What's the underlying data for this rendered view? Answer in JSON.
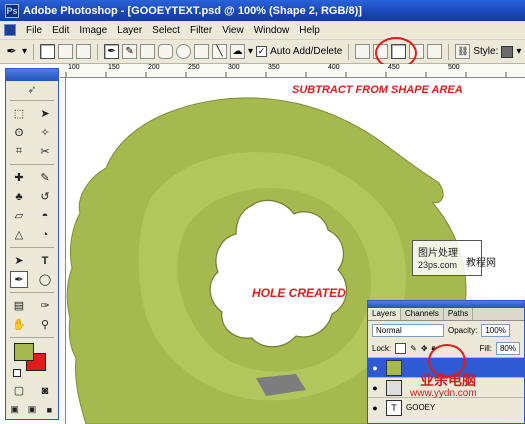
{
  "window": {
    "title": "Adobe Photoshop - [GOOEYTEXT.psd @ 100% (Shape 2, RGB/8)]"
  },
  "menu": [
    "File",
    "Edit",
    "Image",
    "Layer",
    "Select",
    "Filter",
    "View",
    "Window",
    "Help"
  ],
  "options_bar": {
    "auto_add_delete_label": "Auto Add/Delete",
    "auto_add_delete_checked": true,
    "style_label": "Style:"
  },
  "ruler": {
    "ticks": [
      "100",
      "150",
      "200",
      "250",
      "300",
      "350",
      "400",
      "450",
      "500"
    ]
  },
  "annotations": {
    "subtract": "SUBTRACT FROM SHAPE AREA",
    "hole": "HOLE CREATED"
  },
  "layers_panel": {
    "tabs": [
      "Layers",
      "Channels",
      "Paths"
    ],
    "blend_mode": "Normal",
    "opacity_label": "Opacity:",
    "opacity_value": "100%",
    "lock_label": "Lock:",
    "fill_label": "Fill:",
    "fill_value": "80%",
    "layers": [
      {
        "name": "",
        "selected": true,
        "thumb": "shape"
      },
      {
        "name": "",
        "selected": false,
        "thumb": "mask"
      },
      {
        "name": "GOOEY",
        "selected": false,
        "thumb": "T"
      }
    ]
  },
  "watermark": {
    "line1": "图片处理",
    "line2": "23ps.com",
    "line3": "教程网",
    "site": "www.yydn.com",
    "brand": "业余电脑"
  },
  "colors": {
    "shape_green": "#a5b94e",
    "shape_green_light": "#b3c65d",
    "foreground": "#a5b94e",
    "background": "#e21b1b",
    "accent_red": "#e21b1b"
  }
}
